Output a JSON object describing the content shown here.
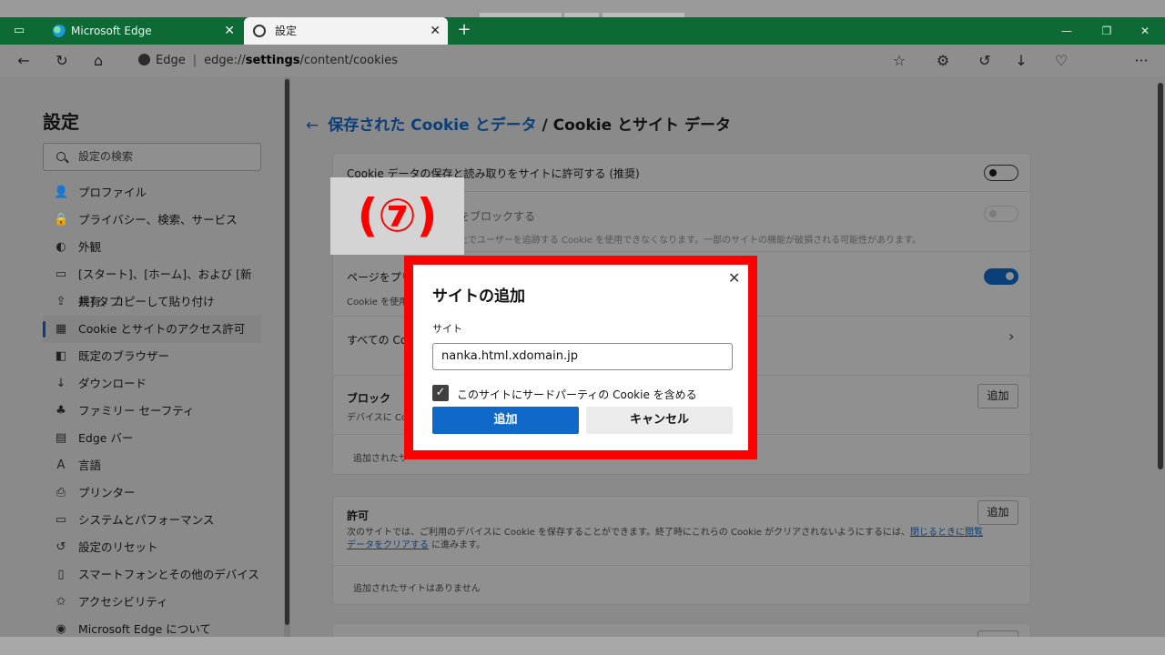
{
  "browser": {
    "tabs": [
      {
        "title": "Microsoft Edge",
        "icon": "edge-logo-icon"
      },
      {
        "title": "設定",
        "icon": "gear-icon"
      }
    ],
    "close_glyph": "✕",
    "new_tab_glyph": "+",
    "window_controls": {
      "minimize": "—",
      "restore": "❐",
      "close": "✕"
    },
    "address": {
      "site_label": "Edge",
      "url_prefix": "edge://",
      "url_host": "settings",
      "url_path": "/content/cookies"
    },
    "toolbar_glyphs": {
      "back": "←",
      "refresh": "↻",
      "home": "⌂",
      "favorites": "☆",
      "extensions": "⚙",
      "history": "↺",
      "downloads": "↓",
      "health": "♡",
      "more": "···"
    }
  },
  "sidebar": {
    "title": "設定",
    "search_placeholder": "設定の検索",
    "items": [
      {
        "label": "プロファイル",
        "icon": "👤"
      },
      {
        "label": "プライバシー、検索、サービス",
        "icon": "🔒"
      },
      {
        "label": "外観",
        "icon": "◐"
      },
      {
        "label": "[スタート]、[ホーム]、および [新規] タブ",
        "icon": "▭"
      },
      {
        "label": "共有、コピーして貼り付け",
        "icon": "⇪"
      },
      {
        "label": "Cookie とサイトのアクセス許可",
        "icon": "▦",
        "active": true
      },
      {
        "label": "既定のブラウザー",
        "icon": "◧"
      },
      {
        "label": "ダウンロード",
        "icon": "↓"
      },
      {
        "label": "ファミリー セーフティ",
        "icon": "♣"
      },
      {
        "label": "Edge バー",
        "icon": "▤"
      },
      {
        "label": "言語",
        "icon": "A"
      },
      {
        "label": "プリンター",
        "icon": "⎙"
      },
      {
        "label": "システムとパフォーマンス",
        "icon": "▭"
      },
      {
        "label": "設定のリセット",
        "icon": "↺"
      },
      {
        "label": "スマートフォンとその他のデバイス",
        "icon": "▯"
      },
      {
        "label": "アクセシビリティ",
        "icon": "✩"
      },
      {
        "label": "Microsoft Edge について",
        "icon": "◉"
      }
    ]
  },
  "main": {
    "breadcrumb_back": "←",
    "breadcrumb_link": "保存された Cookie とデータ",
    "breadcrumb_sep": " / ",
    "breadcrumb_current": "Cookie とサイト データ",
    "rows": {
      "allow_cookies": "Cookie データの保存と読み取りをサイトに許可する (推奨)",
      "block_third_party_visible": "をブロックする",
      "block_third_party_desc_visible": "上でユーザーを追跡する Cookie を使用できなくなります。一部のサイトの機能が破損される可能性があります。",
      "preload_title_visible": "ページをプリロ",
      "preload_desc_visible": "Cookie を使用",
      "all_cookies_visible": "すべての Co"
    },
    "block_section": {
      "title": "ブロック",
      "desc_visible": "デバイスに Coo",
      "empty_visible": "追加されたサ",
      "add_label": "追加"
    },
    "allow_section": {
      "title": "許可",
      "desc_text": "次のサイトでは、ご利用のデバイスに Cookie を保存することができます。終了時にこれらの Cookie がクリアされないようにするには、",
      "desc_link": "閉じるときに閲覧データをクリアする",
      "desc_suffix": " に進みます。",
      "empty": "追加されたサイトはありません",
      "add_label": "追加"
    }
  },
  "annotation": {
    "label": "(⑦)"
  },
  "dialog": {
    "title": "サイトの追加",
    "close_glyph": "✕",
    "field_label": "サイト",
    "field_value": "nanka.html.xdomain.jp",
    "checkbox_checked": true,
    "checkbox_glyph": "✓",
    "checkbox_label": "このサイトにサードパーティの Cookie を含める",
    "primary_label": "追加",
    "secondary_label": "キャンセル"
  },
  "colors": {
    "tabbar": "#0e6a35",
    "link": "#0b3f7a",
    "dialog_border": "#ff0000",
    "primary_button": "#1068c8"
  }
}
